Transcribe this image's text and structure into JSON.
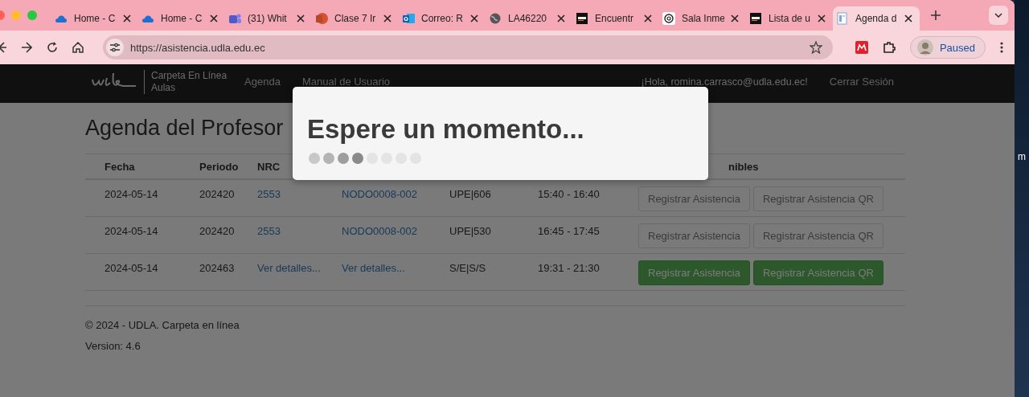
{
  "browser": {
    "tabs": [
      {
        "title": "Home - C",
        "selected": false
      },
      {
        "title": "Home - C",
        "selected": false
      },
      {
        "title": "(31) Whit",
        "selected": false
      },
      {
        "title": "Clase 7 Ir",
        "selected": false
      },
      {
        "title": "Correo: R",
        "selected": false
      },
      {
        "title": "LA46220",
        "selected": false
      },
      {
        "title": "Encuentr",
        "selected": false
      },
      {
        "title": "Sala Inme",
        "selected": false
      },
      {
        "title": "Lista de u",
        "selected": false
      },
      {
        "title": "Agenda d",
        "selected": true
      }
    ],
    "address": "https://asistencia.udla.edu.ec",
    "profile": "Paused"
  },
  "site": {
    "logo_lines": [
      "Carpeta En Línea",
      "Aulas"
    ],
    "nav": [
      "Agenda",
      "Manual de Usuario"
    ],
    "greeting": "¡Hola, romina.carrasco@udla.edu.ec!",
    "logout": "Cerrar Sesión"
  },
  "heading": "Agenda del Profesor",
  "table": {
    "columns": [
      {
        "label": "Fecha"
      },
      {
        "label": "Periodo"
      },
      {
        "label": "NRC"
      },
      {
        "label": "nibles",
        "kind": "clipped"
      }
    ],
    "rows": [
      {
        "fecha": "2024-05-14",
        "periodo": "202420",
        "nrc": "2553",
        "course": "NODO0008-002",
        "room": "UPE|606",
        "time": "15:40 - 16:40",
        "buttons": [
          {
            "label": "Registrar Asistencia",
            "disabled": true
          },
          {
            "label": "Registrar Asistencia QR",
            "disabled": true
          }
        ]
      },
      {
        "fecha": "2024-05-14",
        "periodo": "202420",
        "nrc": "2553",
        "course": "NODO0008-002",
        "room": "UPE|530",
        "time": "16:45 - 17:45",
        "buttons": [
          {
            "label": "Registrar Asistencia",
            "disabled": true
          },
          {
            "label": "Registrar Asistencia QR",
            "disabled": true
          }
        ]
      },
      {
        "fecha": "2024-05-14",
        "periodo": "202463",
        "nrc": "Ver detalles...",
        "course": "Ver detalles...",
        "room": "S/E|S/S",
        "time": "19:31 - 21:30",
        "buttons": [
          {
            "label": "Registrar Asistencia",
            "disabled": false
          },
          {
            "label": "Registrar Asistencia QR",
            "disabled": false
          }
        ]
      }
    ]
  },
  "footer": [
    "© 2024 - UDLA. Carpeta en línea",
    "Version: 4.6"
  ],
  "modal": {
    "title": "Espere un momento..."
  },
  "desktop": {
    "text": "m"
  }
}
